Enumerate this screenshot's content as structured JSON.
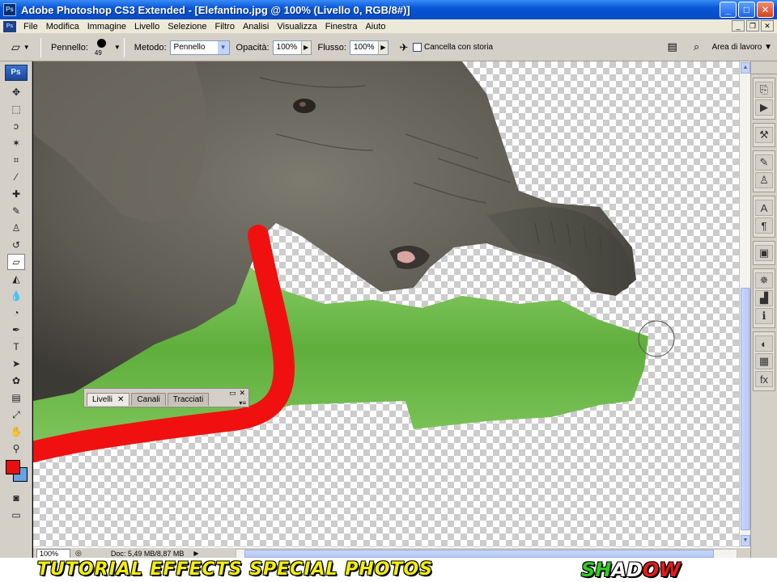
{
  "window": {
    "title": "Adobe Photoshop CS3 Extended - [Elefantino.jpg @ 100% (Livello 0, RGB/8#)]",
    "app_icon_label": "Ps",
    "buttons": {
      "minimize": "_",
      "maximize": "□",
      "close": "✕"
    }
  },
  "menu": {
    "items": [
      "File",
      "Modifica",
      "Immagine",
      "Livello",
      "Selezione",
      "Filtro",
      "Analisi",
      "Visualizza",
      "Finestra",
      "Aiuto"
    ]
  },
  "options": {
    "brush_label": "Pennello:",
    "brush_size": "49",
    "method_label": "Metodo:",
    "method_value": "Pennello",
    "opacity_label": "Opacità:",
    "opacity_value": "100%",
    "flow_label": "Flusso:",
    "flow_value": "100%",
    "erase_history_label": "Cancella con storia",
    "workspace_label": "Area di lavoro"
  },
  "toolbox": {
    "logo": "Ps",
    "tools": [
      {
        "name": "move-tool-icon",
        "glyph": "✥"
      },
      {
        "name": "marquee-tool-icon",
        "glyph": "⬚"
      },
      {
        "name": "lasso-tool-icon",
        "glyph": "ↄ"
      },
      {
        "name": "magic-wand-tool-icon",
        "glyph": "✶"
      },
      {
        "name": "crop-tool-icon",
        "glyph": "⌗"
      },
      {
        "name": "slice-tool-icon",
        "glyph": "⁄"
      },
      {
        "name": "healing-brush-tool-icon",
        "glyph": "✚"
      },
      {
        "name": "brush-tool-icon",
        "glyph": "✎"
      },
      {
        "name": "clone-stamp-tool-icon",
        "glyph": "♙"
      },
      {
        "name": "history-brush-tool-icon",
        "glyph": "↺"
      },
      {
        "name": "eraser-tool-icon",
        "glyph": "▱",
        "active": true
      },
      {
        "name": "paint-bucket-tool-icon",
        "glyph": "◭"
      },
      {
        "name": "blur-tool-icon",
        "glyph": "💧"
      },
      {
        "name": "dodge-tool-icon",
        "glyph": "◔"
      },
      {
        "name": "pen-tool-icon",
        "glyph": "✒"
      },
      {
        "name": "type-tool-icon",
        "glyph": "T"
      },
      {
        "name": "path-selection-tool-icon",
        "glyph": "➤"
      },
      {
        "name": "custom-shape-tool-icon",
        "glyph": "✿"
      },
      {
        "name": "notes-tool-icon",
        "glyph": "▤"
      },
      {
        "name": "eyedropper-tool-icon",
        "glyph": "⤢"
      },
      {
        "name": "hand-tool-icon",
        "glyph": "✋"
      },
      {
        "name": "zoom-tool-icon",
        "glyph": "⚲"
      }
    ],
    "foreground_color": "#e61010",
    "background_color": "#66a3e0"
  },
  "status": {
    "zoom": "100%",
    "doc": "Doc: 5,49 MB/8,87 MB"
  },
  "floating_panel": {
    "tabs": [
      "Livelli",
      "Canali",
      "Tracciati"
    ]
  },
  "dock": {
    "groups": [
      [
        "history-icon",
        "actions-icon"
      ],
      [
        "tool-presets-icon"
      ],
      [
        "brushes-icon",
        "clone-source-icon"
      ],
      [
        "character-icon",
        "paragraph-icon"
      ],
      [
        "layer-comps-icon"
      ],
      [
        "navigator-icon",
        "histogram-icon",
        "info-icon"
      ],
      [
        "color-icon",
        "swatches-icon",
        "styles-icon"
      ]
    ],
    "glyphs": {
      "history-icon": "⎘",
      "actions-icon": "▶",
      "tool-presets-icon": "⚒",
      "brushes-icon": "✎",
      "clone-source-icon": "♙",
      "character-icon": "A",
      "paragraph-icon": "¶",
      "layer-comps-icon": "▣",
      "navigator-icon": "✵",
      "histogram-icon": "▟",
      "info-icon": "ℹ",
      "color-icon": "◐",
      "swatches-icon": "▦",
      "styles-icon": "fx"
    }
  },
  "banner": {
    "left": "TUTORIAL EFFECTS SPECIAL PHOTOS",
    "right_parts": [
      "SH",
      "AD",
      "OW"
    ]
  }
}
